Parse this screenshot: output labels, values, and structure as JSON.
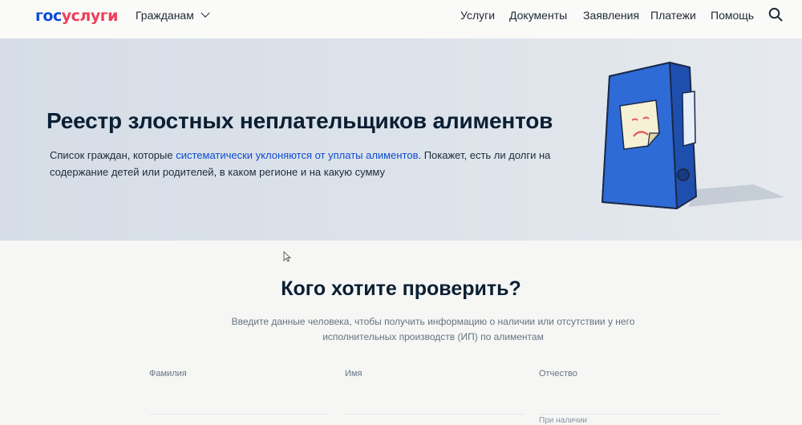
{
  "header": {
    "logo_part1": "гос",
    "logo_part2": "услуги",
    "role": "Гражданам",
    "nav": [
      "Услуги",
      "Документы",
      "Заявления",
      "Платежи",
      "Помощь"
    ]
  },
  "hero": {
    "title": "Реестр злостных неплательщиков алиментов",
    "text_before": "Список граждан, которые ",
    "text_link": "систематически уклоняются от уплаты алиментов",
    "text_after": ". Покажет, есть ли долги на содержание детей или родителей, в каком регионе и на какую сумму"
  },
  "check": {
    "title": "Кого хотите проверить?",
    "subtitle": "Введите данные человека, чтобы получить информацию о наличии или отсутствии у него исполнительных производств (ИП) по алиментам",
    "fields": [
      {
        "label": "Фамилия"
      },
      {
        "label": "Имя"
      },
      {
        "label": "Отчество"
      }
    ],
    "patronymic_hint": "При наличии"
  },
  "colors": {
    "brand_blue": "#0d4cd3",
    "brand_red": "#ee3f58",
    "binder_blue": "#2f6bd6"
  }
}
